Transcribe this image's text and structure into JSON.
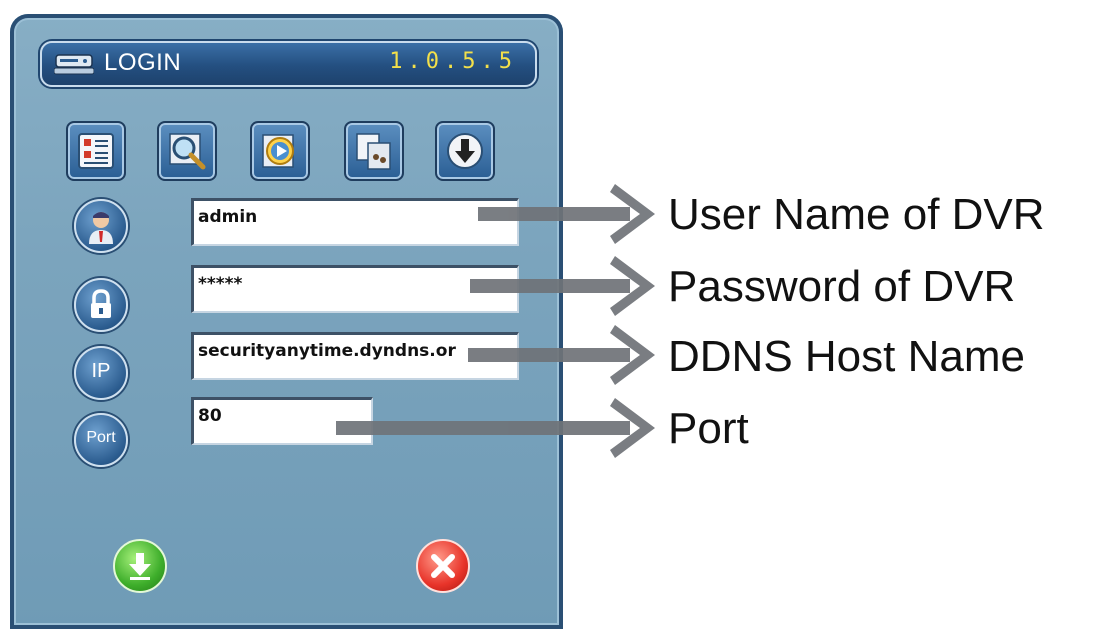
{
  "window": {
    "title": "LOGIN",
    "version": "1.0.5.5"
  },
  "toolbar": {
    "buttons": [
      {
        "icon": "address-book-icon"
      },
      {
        "icon": "search-icon"
      },
      {
        "icon": "playback-icon"
      },
      {
        "icon": "copy-icon"
      },
      {
        "icon": "download-icon"
      }
    ]
  },
  "form": {
    "username": {
      "icon": "user-icon",
      "value": "admin"
    },
    "password": {
      "icon": "lock-icon",
      "value": "*****"
    },
    "host": {
      "icon": "ip-icon",
      "icon_text": "IP",
      "value": "securityanytime.dyndns.or"
    },
    "port": {
      "icon": "port-icon",
      "icon_text": "Port",
      "value": "80"
    }
  },
  "actions": {
    "ok_icon": "confirm-icon",
    "cancel_icon": "close-icon"
  },
  "callouts": {
    "username": "User Name of DVR",
    "password": "Password of DVR",
    "host": "DDNS Host Name",
    "port": "Port"
  },
  "colors": {
    "panel": "#7ba4bd",
    "title_bar": "#244f80",
    "version": "#f3e04a",
    "arrow": "#6f7378"
  }
}
